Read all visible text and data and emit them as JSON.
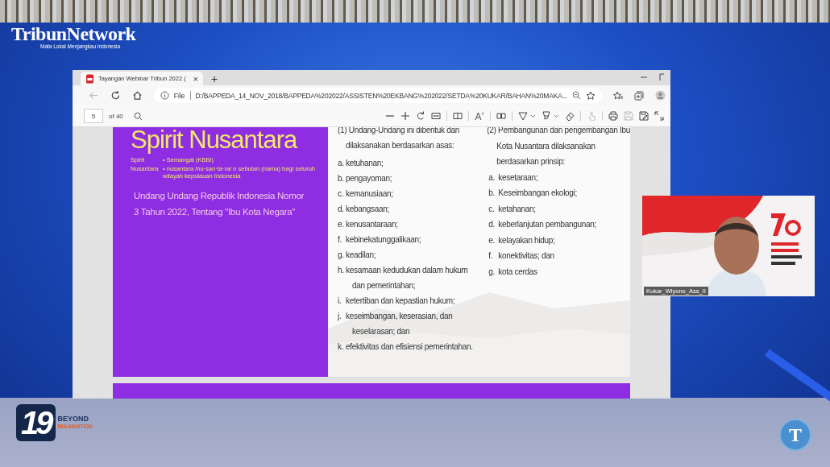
{
  "broadcast": {
    "logo": {
      "name": "TribunNetwork",
      "tagline": "Mata Lokal Menjangkau Indonesia"
    },
    "event_badge": {
      "number": "19",
      "line_1": "BEYOND",
      "line_2": "IMAGINATION"
    },
    "corner_logo": "T"
  },
  "browser": {
    "tab": {
      "title": "Tayangan Webinar Tribun 2022 (",
      "close": "×"
    },
    "new_tab": "+",
    "address": {
      "scheme": "File",
      "url": "D:/BAPPEDA_14_NOV_2018/BAPPEDA%202022/ASSISTEN%20EKBANG%202022/SETDA%20KUKAR/BAHAN%20MAKA..."
    },
    "pdf_toolbar": {
      "page": "5",
      "page_count": "of 40"
    }
  },
  "slide": {
    "title": "Spirit Nusantara",
    "glossary": [
      {
        "term": "Spirit",
        "definition": "• Semangat (KBBI)"
      },
      {
        "term": "Nusantara",
        "definition": "• nusantara /nu·san·ta·ra/ n sebutan (nama) bagi seluruh wilayah kepulauan Indonesia"
      }
    ],
    "subtitle": [
      "Undang Undang Republik Indonesia Nomor",
      "3 Tahun 2022, Tentang \"Ibu Kota Negara\""
    ],
    "columns": [
      {
        "intro": [
          "(1) Undang-Undang ini dibentuk dan",
          "dilaksanakan berdasarkan asas:"
        ],
        "items": [
          {
            "letter": "a.",
            "lines": [
              "ketuhanan;"
            ]
          },
          {
            "letter": "b.",
            "lines": [
              "pengayoman;"
            ]
          },
          {
            "letter": "c.",
            "lines": [
              "kemanusiaan;"
            ]
          },
          {
            "letter": "d.",
            "lines": [
              "kebangsaan;"
            ]
          },
          {
            "letter": "e.",
            "lines": [
              "kenusantaraan;"
            ]
          },
          {
            "letter": "f.",
            "lines": [
              "kebinekatunggalikaan;"
            ]
          },
          {
            "letter": "g.",
            "lines": [
              "keadilan;"
            ]
          },
          {
            "letter": "h.",
            "lines": [
              "kesamaan kedudukan dalam hukum",
              "dan pemerintahan;"
            ]
          },
          {
            "letter": "i.",
            "lines": [
              "ketertiban dan kepastian hukum;"
            ]
          },
          {
            "letter": "j.",
            "lines": [
              "keseimbangan, keserasian, dan",
              "keselarasan; dan"
            ]
          },
          {
            "letter": "k.",
            "lines": [
              "efektivitas dan efisiensi pemerintahan."
            ]
          }
        ]
      },
      {
        "intro": [
          "(2) Pembangunan dan pengembangan Ibu",
          "Kota Nusantara dilaksanakan",
          "berdasarkan prinsip:"
        ],
        "items": [
          {
            "letter": "a.",
            "lines": [
              "kesetaraan;"
            ]
          },
          {
            "letter": "b.",
            "lines": [
              "Keseimbangan ekologi;"
            ]
          },
          {
            "letter": "c.",
            "lines": [
              "ketahanan;"
            ]
          },
          {
            "letter": "d.",
            "lines": [
              "keberlanjutan pembangunan;"
            ]
          },
          {
            "letter": "e.",
            "lines": [
              "kelayakan hidup;"
            ]
          },
          {
            "letter": "f.",
            "lines": [
              "konektivitas; dan"
            ]
          },
          {
            "letter": "g.",
            "lines": [
              "kota cerdas"
            ]
          }
        ]
      }
    ]
  },
  "webcam": {
    "participant": "Kukar_Wiyono_Ass_II"
  }
}
